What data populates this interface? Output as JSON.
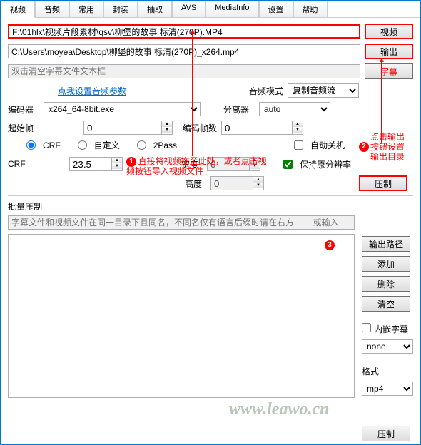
{
  "tabs": [
    "视频",
    "音频",
    "常用",
    "封装",
    "抽取",
    "AVS",
    "MediaInfo",
    "设置",
    "帮助"
  ],
  "inputs": {
    "video_path": "F:\\01hlx\\视频片段素材\\qsv\\柳堡的故事 标清(270P).MP4",
    "output_path": "C:\\Users\\moyea\\Desktop\\柳堡的故事 标清(270P)_x264.mp4",
    "subtitle_placeholder": "双击清空字幕文件文本框",
    "batch_placeholder": "字幕文件和视频文件在同一目录下且同名，不同名仅有语言后缀时请在右方        或输入"
  },
  "buttons": {
    "video": "视频",
    "output": "输出",
    "subtitle": "字幕",
    "compress": "压制",
    "output_path": "输出路径",
    "add": "添加",
    "delete": "删除",
    "clear": "清空",
    "compress2": "压制"
  },
  "links": {
    "audio_params": "点我设置音频参数"
  },
  "labels": {
    "audio_mode": "音频模式",
    "encoder": "编码器",
    "demuxer": "分离器",
    "start_frame": "起始帧",
    "frame_count": "编码帧数",
    "crf_radio": "CRF",
    "custom_radio": "自定义",
    "twopass": "2Pass",
    "auto_shutdown": "自动关机",
    "crf_label": "CRF",
    "width": "宽度",
    "height": "高度",
    "keep_res": "保持原分辨率",
    "batch": "批量压制",
    "embed_sub": "内嵌字幕",
    "format": "格式"
  },
  "values": {
    "audio_mode": "复制音频流",
    "encoder": "x264_64-8bit.exe",
    "demuxer": "auto",
    "start_frame": "0",
    "frame_count": "0",
    "crf": "23.5",
    "width": "0",
    "height": "0",
    "sub_mode": "none",
    "format": "mp4"
  },
  "annotations": {
    "a1": "直接将视频拖至此处，或者点击视频按钮导入视频文件",
    "a2": "点击输出按钮设置输出目录"
  },
  "watermark": "www.leawo.cn"
}
